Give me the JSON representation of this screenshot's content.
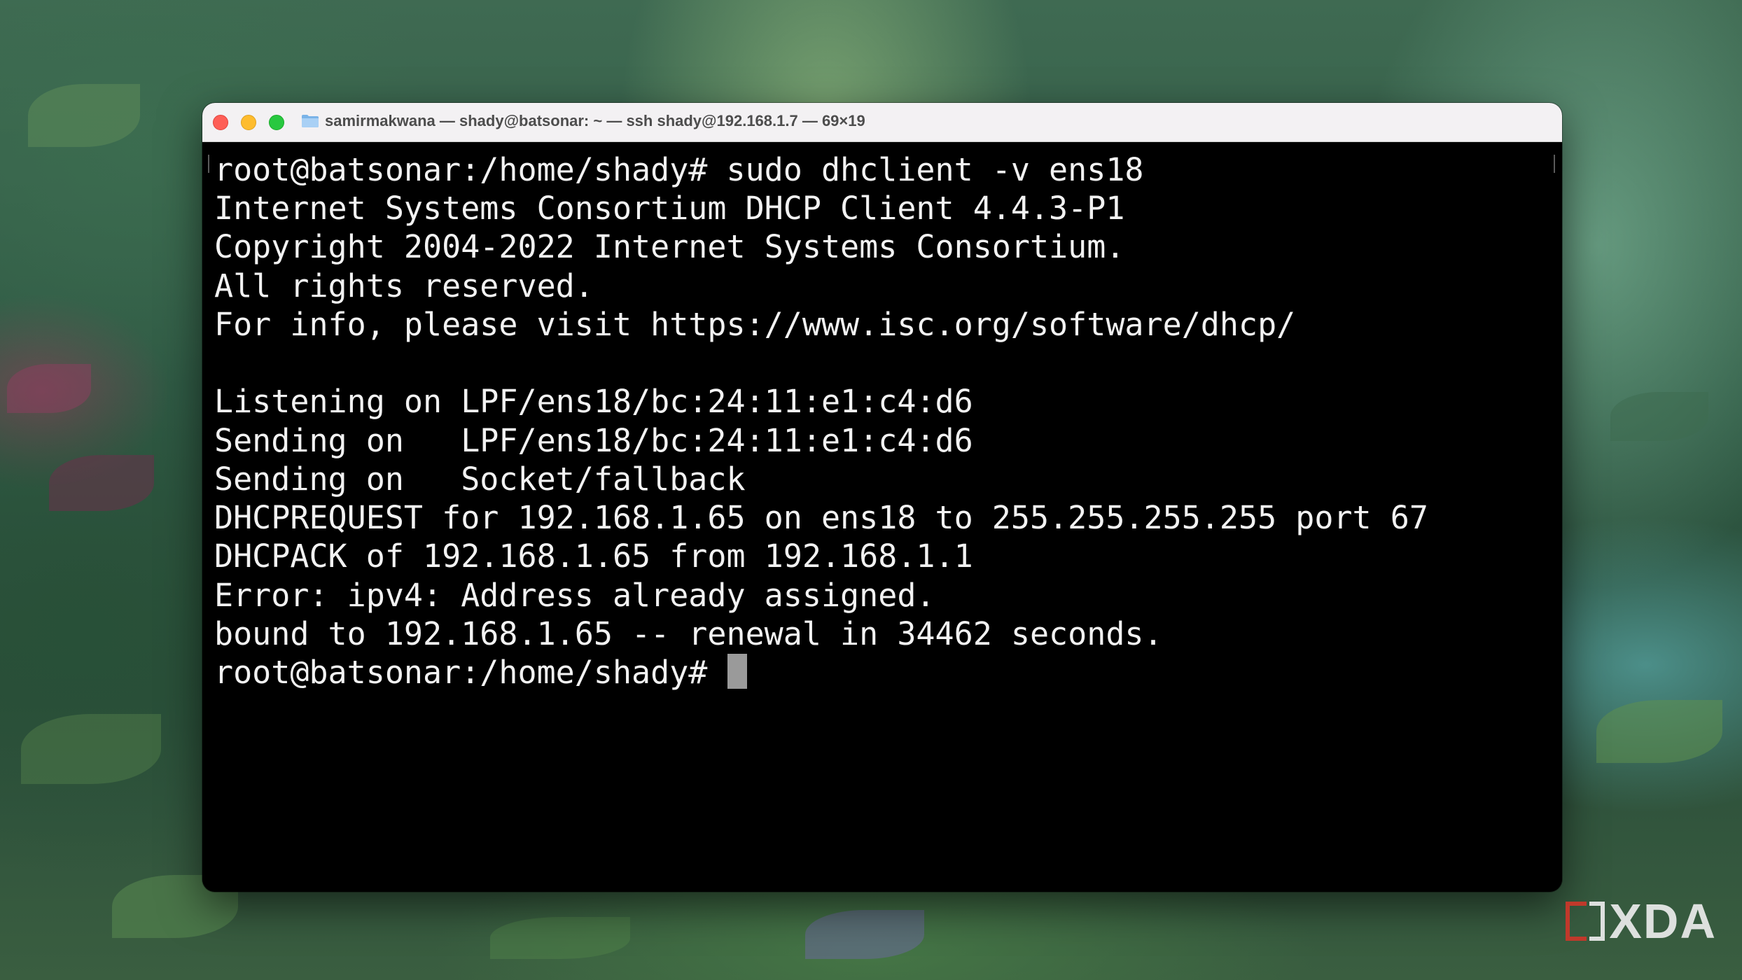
{
  "window": {
    "title": "samirmakwana — shady@batsonar: ~ — ssh shady@192.168.1.7 — 69×19",
    "folder_icon": "folder-icon"
  },
  "terminal": {
    "lines": [
      "root@batsonar:/home/shady# sudo dhclient -v ens18",
      "Internet Systems Consortium DHCP Client 4.4.3-P1",
      "Copyright 2004-2022 Internet Systems Consortium.",
      "All rights reserved.",
      "For info, please visit https://www.isc.org/software/dhcp/",
      "",
      "Listening on LPF/ens18/bc:24:11:e1:c4:d6",
      "Sending on   LPF/ens18/bc:24:11:e1:c4:d6",
      "Sending on   Socket/fallback",
      "DHCPREQUEST for 192.168.1.65 on ens18 to 255.255.255.255 port 67",
      "DHCPACK of 192.168.1.65 from 192.168.1.1",
      "Error: ipv4: Address already assigned.",
      "bound to 192.168.1.65 -- renewal in 34462 seconds."
    ],
    "prompt": "root@batsonar:/home/shady# "
  },
  "watermark": {
    "text": "XDA"
  },
  "colors": {
    "terminal_bg": "#000000",
    "terminal_fg": "#f2f2f2",
    "cursor": "#9a9a9a",
    "close": "#fe5f57",
    "minimize": "#febc2e",
    "zoom": "#28c840"
  }
}
